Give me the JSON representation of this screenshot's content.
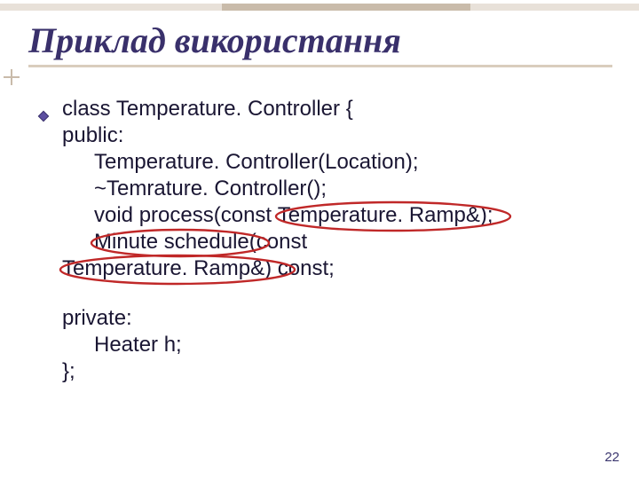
{
  "title": "Приклад використання",
  "code": {
    "l1": "class Temperature. Controller {",
    "l2": "public:",
    "l3": "Temperature. Controller(Location);",
    "l4": "~Temrature. Controller();",
    "l5_pre": "void process(const ",
    "l5_circ": "Temperature. Ramp&",
    "l5_post": ");",
    "l6_pre": "Minute schedule",
    "l6_post": "(const",
    "l7_pre": "",
    "l7_circ": "Temperature. Ramp&",
    "l7_post": ") const;",
    "l8": "private:",
    "l9": "Heater h;",
    "l10": "};"
  },
  "page_number": "22",
  "colors": {
    "title": "#39306b",
    "circle": "#c02828",
    "accent": "#5c4fa0"
  }
}
